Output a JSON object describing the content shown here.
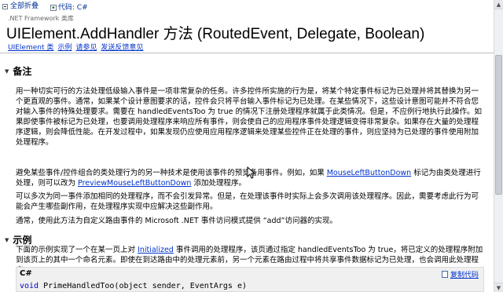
{
  "toolbar": {
    "collapse_all_label": "全部折叠",
    "code_label": "代码: C#"
  },
  "header": {
    "library": ".NET Framework 类库",
    "title": "UIElement.AddHandler 方法  (RoutedEvent, Delegate, Boolean)",
    "links": [
      "UIElement 类",
      "示例",
      "请参见",
      "发送反馈意见"
    ]
  },
  "remarks": {
    "heading": "备注",
    "p1": "用一种切实可行的方法处理低级输入事件是一项非常复杂的任务。许多控件所实施的行为是，将某个特定事件标记为已处理并将其替换为另一个更直观的事件。通常，如果某个设计意图要求的话，控件会只将平台输入事件标记为已处理。在某些情况下，这些设计意图可能并不符合您对输入事件的特殊处理要求。需要在 handledEventsToo 为 true 的情况下注册处理程序就属于此类情况。但是，不应例行地执行此操作。如果即使事件被标记为已处理，也要调用处理程序来响应所有事件，则会使自己的应用程序事件处理逻辑变得非常复杂。如果存在大量的处理程序逻辑，则会降低性能。在开发过程中，如果发现仍应使用应用程序逻辑来处理某些控件正在处理的事件，则应坚持为已处理的事件使用附加处理程序。",
    "p2_before": "避免某些事件/控件组合的类处理行为的另一种技术是使用该事件的预览备用事件。例如，如果 ",
    "p2_link1": "MouseLeftButtonDown",
    "p2_middle": " 标记为由类处理进行处理，则可以改为 ",
    "p2_link2": "PreviewMouseLeftButtonDown",
    "p2_after": " 添加处理程序。",
    "p3": "可以多次为同一事件添加相同的处理程序，而不会引发异常。但是，在处理该事件时实际上会多次调用该处理程序。因此，需要考虑此行为可能会产生哪些副作用，在处理程序实现中应解决这些副作用。",
    "p4": "通常，使用此方法为自定义路由事件的 Microsoft .NET 事件访问模式提供 “add”访问器的实现。"
  },
  "example": {
    "heading": "示例",
    "p_before": "下面的示例实现了一个在某一页上对 ",
    "p_link": "Initialized",
    "p_after": " 事件调用的处理程序，该页通过指定 handledEventsToo 为 true，将已定义的处理程序附加到该页上的其中一个命名元素。即使在到达路由中的处理元素前，另一个元素在路由过程中将共享事件数据标记为已处理，也会调用此处理程序。",
    "code_lang": "C#",
    "copy_label": "复制代码",
    "code_kw": "void",
    "code_rest": " PrimeHandledToo(object sender, EventArgs e)"
  }
}
